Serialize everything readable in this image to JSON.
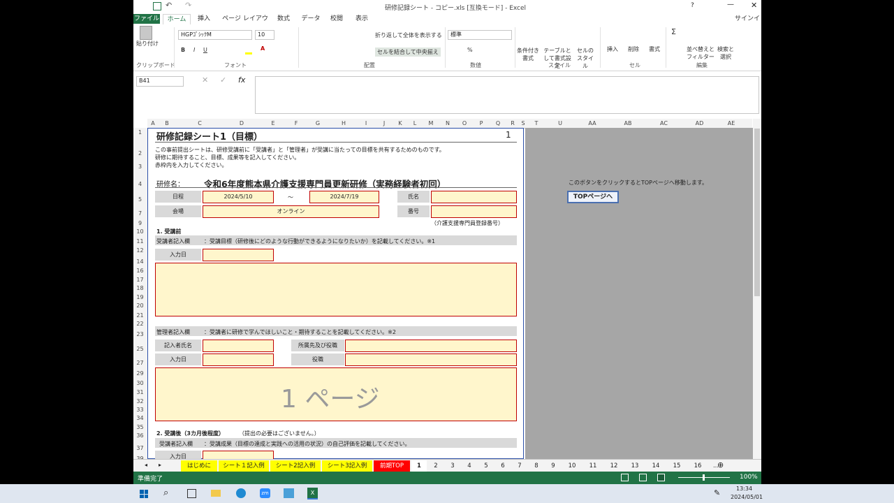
{
  "window": {
    "title": "研修記録シート - コピー.xls  [互換モード] - Excel",
    "help": "?",
    "sign_in": "サインイン"
  },
  "ribbon_tabs": [
    "ファイル",
    "ホーム",
    "挿入",
    "ページ レイアウト",
    "数式",
    "データ",
    "校閲",
    "表示"
  ],
  "ribbon": {
    "clipboard": {
      "paste": "貼り付け",
      "group": "クリップボード"
    },
    "font": {
      "name": "HGPｺﾞｼｯｸM",
      "size": "10",
      "bold": "B",
      "italic": "I",
      "underline": "U",
      "group": "フォント"
    },
    "alignment": {
      "wrap": "折り返して全体を表示する",
      "merge": "セルを結合して中央揃え",
      "group": "配置"
    },
    "number": {
      "format": "標準",
      "group": "数値"
    },
    "styles": {
      "conditional": "条件付き書式",
      "table": "テーブルとして書式設定",
      "cell": "セルのスタイル",
      "group": "スタイル"
    },
    "cells": {
      "insert": "挿入",
      "delete": "削除",
      "format": "書式",
      "group": "セル"
    },
    "editing": {
      "sort": "並べ替えとフィルター",
      "find": "検索と選択",
      "group": "編集"
    }
  },
  "formula_bar": {
    "name_box": "B41",
    "fx": "fx",
    "content": ""
  },
  "columns": [
    "A",
    "B",
    "C",
    "D",
    "E",
    "F",
    "G",
    "H",
    "I",
    "J",
    "K",
    "L",
    "M",
    "N",
    "O",
    "P",
    "Q",
    "R",
    "S",
    "T",
    "U",
    "AA",
    "AB",
    "AC",
    "AD",
    "AE"
  ],
  "rows": [
    "1",
    "2",
    "3",
    "4",
    "5",
    "7",
    "9",
    "10",
    "11",
    "12",
    "14",
    "16",
    "17",
    "18",
    "19",
    "20",
    "21",
    "22",
    "23",
    "25",
    "27",
    "29",
    "30",
    "31",
    "32",
    "33",
    "34",
    "35",
    "36",
    "37",
    "39"
  ],
  "sheet": {
    "title": "研修記録シート1（目標）",
    "page_no": "1",
    "intro_1": "この事前提出シートは、研修受講前に「受講者」と「管理者」が受講に当たっての目標を共有するためのものです。",
    "intro_2": "研修に期待すること、目標、成果等を記入してください。",
    "intro_3": "赤枠内を入力してください。",
    "training_label": "研修名：",
    "training_name": "令和6年度熊本県介護支援専門員更新研修（実務経験者初回）",
    "date_label": "日程",
    "date_from": "2024/5/10",
    "tilde": "～",
    "date_to": "2024/7/19",
    "name_label": "氏名",
    "venue_label": "会場",
    "venue": "オンライン",
    "number_label": "番号",
    "number_note": "（介護支援専門員登録番号）",
    "sec1": "1. 受講前",
    "trainee_label": "受講者記入欄",
    "trainee_desc": "：受講目標（研修後にどのような行動ができるようになりたいか）を記載してください。※1",
    "input_date": "入力日",
    "manager_label": "管理者記入欄",
    "manager_desc": "：受講者に研修で学んでほしいこと・期待することを記載してください。※2",
    "writer_name": "記入者氏名",
    "affiliation": "所属先及び役職",
    "input_date2": "入力日",
    "position": "役職",
    "page_watermark": "1 ページ",
    "sec2": "2. 受講後（3カ月後程度）",
    "sec2_note": "（提出の必要はございません。）",
    "trainee_label2": "受講者記入欄",
    "trainee_desc2": "：受講成果（目標の達成と実践への活用の状況）の自己評価を記載してください。",
    "input_date3": "入力日"
  },
  "side": {
    "note": "このボタンをクリックするとTOPページへ移動します。",
    "top_button": "TOPページへ"
  },
  "sheet_tabs": [
    {
      "label": "はじめに",
      "color": "#ffff00"
    },
    {
      "label": "シート１記入例",
      "color": "#ffff00"
    },
    {
      "label": "シート2記入例",
      "color": "#ffff00"
    },
    {
      "label": "シート3記入例",
      "color": "#ffff00"
    },
    {
      "label": "前期TOP",
      "color": "#ff0000"
    },
    {
      "label": "1",
      "color": "#ffffff"
    },
    {
      "label": "2",
      "color": ""
    },
    {
      "label": "3",
      "color": ""
    },
    {
      "label": "4",
      "color": ""
    },
    {
      "label": "5",
      "color": ""
    },
    {
      "label": "6",
      "color": ""
    },
    {
      "label": "7",
      "color": ""
    },
    {
      "label": "8",
      "color": ""
    },
    {
      "label": "9",
      "color": ""
    },
    {
      "label": "10",
      "color": ""
    },
    {
      "label": "11",
      "color": ""
    },
    {
      "label": "12",
      "color": ""
    },
    {
      "label": "13",
      "color": ""
    },
    {
      "label": "14",
      "color": ""
    },
    {
      "label": "15",
      "color": ""
    },
    {
      "label": "16",
      "color": ""
    },
    {
      "label": "...",
      "color": ""
    }
  ],
  "status": {
    "ready": "準備完了",
    "zoom": "100%"
  },
  "taskbar": {
    "time": "13:34",
    "date": "2024/05/01"
  },
  "colors": {
    "excel_green": "#217346",
    "input_bg": "#fff6cc",
    "input_border": "#c00000",
    "label_bg": "#d9d9d9"
  }
}
